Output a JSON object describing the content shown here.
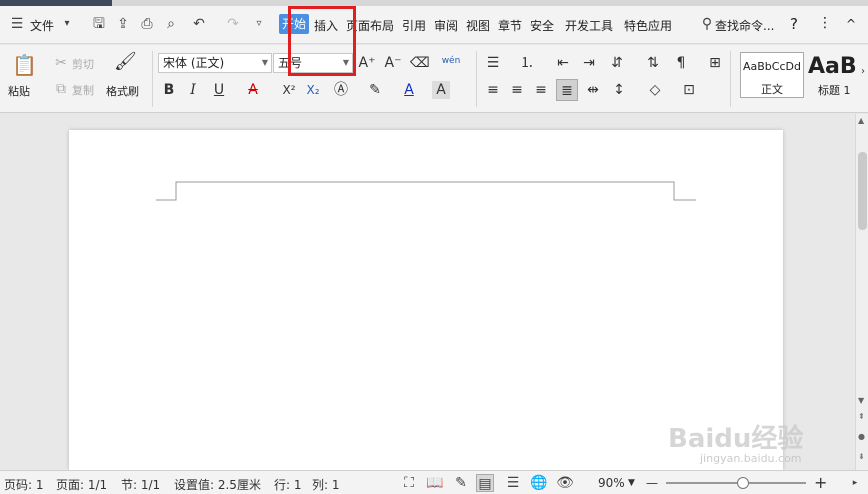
{
  "menubar": {
    "file_label": "文件",
    "tabs": [
      "开始",
      "插入",
      "页面布局",
      "引用",
      "审阅",
      "视图",
      "章节",
      "安全",
      "开发工具",
      "特色应用"
    ],
    "search_label": "查找命令...",
    "help": "?",
    "more": "⋮",
    "collapse": "^"
  },
  "ribbon": {
    "paste_label": "粘贴",
    "cut_label": "剪切",
    "copy_label": "复制",
    "format_painter_label": "格式刷",
    "font_name": "宋体 (正文)",
    "font_size": "五号",
    "bold": "B",
    "italic": "I",
    "underline": "U",
    "strike": "A",
    "superscript": "X²",
    "subscript": "X₂",
    "phonetic": "wén",
    "style_normal_preview": "AaBbCcDd",
    "style_normal_label": "正文",
    "style_h1_preview": "AaB",
    "style_h1_label": "标题 1"
  },
  "status": {
    "page_no": "页码: 1",
    "pages": "页面: 1/1",
    "section": "节: 1/1",
    "setting": "设置值: 2.5厘米",
    "row": "行: 1",
    "col": "列: 1",
    "zoom": "90%",
    "zoom_level": 0.55,
    "minus": "—",
    "plus": "+"
  },
  "watermark": {
    "brand": "Baidu经验",
    "url": "jingyan.baidu.com"
  }
}
